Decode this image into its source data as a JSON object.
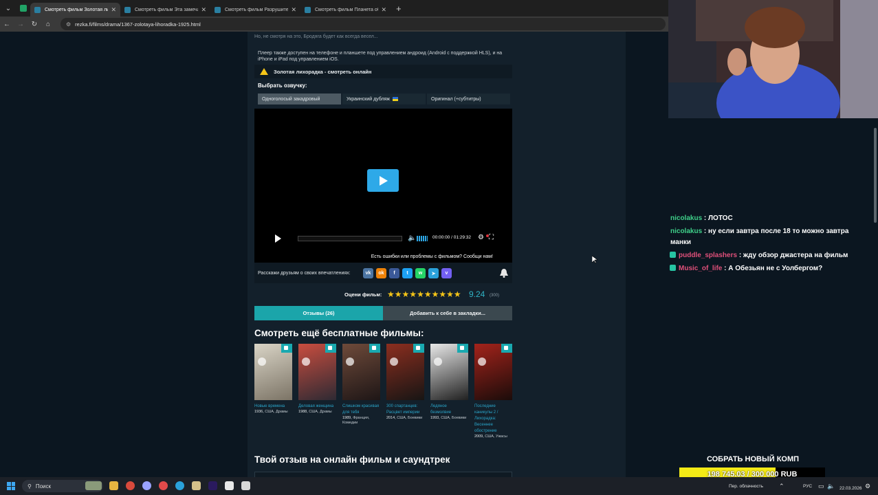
{
  "browser": {
    "tabs": [
      {
        "title": "Смотреть фильм Золотая лихорадка",
        "active": true
      },
      {
        "title": "Смотреть фильм Эта замечательная",
        "active": false
      },
      {
        "title": "Смотреть фильм Разрушитель",
        "active": false
      },
      {
        "title": "Смотреть фильм Планета обезьян",
        "active": false
      }
    ],
    "new_tab": "+",
    "url": "rezka.fi/films/drama/1367-zolotaya-lihoradka-1925.html"
  },
  "page": {
    "intro_text": "Но, не смотря на это, Бродяга будет как всегда весел...",
    "player_note": "Плеер также доступен на телефоне и планшете под управлением андроид (Android с поддержкой HLS), и на iPhone и iPad под управлением iOS.",
    "watch_title": "Золотая лихорадка - смотреть онлайн",
    "voice_label": "Выбрать озвучку:",
    "voice_options": [
      {
        "label": "Одноголосый закадровый",
        "selected": true
      },
      {
        "label": "Украинский дубляж",
        "selected": false
      },
      {
        "label": "Оригинал (+субтитры)",
        "selected": false
      }
    ],
    "player": {
      "time": "00:00:00 / 01:29:32",
      "progress": 0
    },
    "report_text": "Есть ошибки или проблемы с фильмом? Сообщи нам!",
    "share_label": "Расскажи друзьям о своих впечатлениях:",
    "social": [
      {
        "name": "vk-icon",
        "glyph": "vk",
        "color": "#4c75a3"
      },
      {
        "name": "odnoklassniki-icon",
        "glyph": "ok",
        "color": "#ee8208"
      },
      {
        "name": "facebook-icon",
        "glyph": "f",
        "color": "#3b5998"
      },
      {
        "name": "twitter-icon",
        "glyph": "t",
        "color": "#1da1f2"
      },
      {
        "name": "whatsapp-icon",
        "glyph": "w",
        "color": "#25d366"
      },
      {
        "name": "telegram-icon",
        "glyph": "➤",
        "color": "#2aa1da"
      },
      {
        "name": "viber-icon",
        "glyph": "v",
        "color": "#7360f2"
      }
    ],
    "rating_label": "Оцени фильм:",
    "rating_value": "9.24",
    "rating_count": "(300)",
    "rating_stars": 10,
    "reviews_button": "Отзывы (26)",
    "bookmark_button": "Добавить к себе в закладки...",
    "more_heading": "Смотреть ещё бесплатные фильмы:",
    "movies": [
      {
        "title": "Новые времена",
        "year": "1936,",
        "meta": "США, Драмы",
        "c1": "#d9d4c6",
        "c2": "#7c7466"
      },
      {
        "title": "Деловая женщина",
        "year": "1988,",
        "meta": "США, Драмы",
        "c1": "#c94d3f",
        "c2": "#2e2a33"
      },
      {
        "title": "Слишком красивая для тебя",
        "year": "1989,",
        "meta": "Франция, Комедии",
        "c1": "#6e4a3a",
        "c2": "#1e1616"
      },
      {
        "title": "300 спартанцев: Расцвет империи",
        "year": "2014,",
        "meta": "США, Боевики",
        "c1": "#8b2e1f",
        "c2": "#171514"
      },
      {
        "title": "Ледяное безмолвие",
        "year": "1993,",
        "meta": "США, Боевики",
        "c1": "#e8e8e8",
        "c2": "#202020"
      },
      {
        "title": "Последние каникулы 2 / Лихорадка: Весеннее обострение",
        "year": "2009,",
        "meta": "США, Ужасы",
        "c1": "#a3231b",
        "c2": "#1b0c0a"
      }
    ],
    "review_heading": "Твой отзыв на онлайн фильм и саундтрек"
  },
  "chat": [
    {
      "user": "nicolakus",
      "text": ": ЛОТОС",
      "color": "#3fd18a",
      "badge": false
    },
    {
      "user": "nicolakus",
      "text": ": ну если завтра после 18 то можно завтра манки",
      "color": "#3fd18a",
      "badge": false
    },
    {
      "user": "puddle_splashers",
      "text": ": жду обзор джастера на фильм",
      "color": "#e0507a",
      "badge": true
    },
    {
      "user": "Music_of_life",
      "text": ": А Обезьян не с Уолбергом?",
      "color": "#e0507a",
      "badge": true
    }
  ],
  "goal": {
    "title": "СОБРАТЬ НОВЫЙ КОМП",
    "text": "198 745.03 / 300 000 RUB",
    "progress": 0.66
  },
  "taskbar": {
    "search": "Поиск",
    "weather": "Пер. облачность",
    "lang": "РУС",
    "date": "22.03.2026"
  }
}
